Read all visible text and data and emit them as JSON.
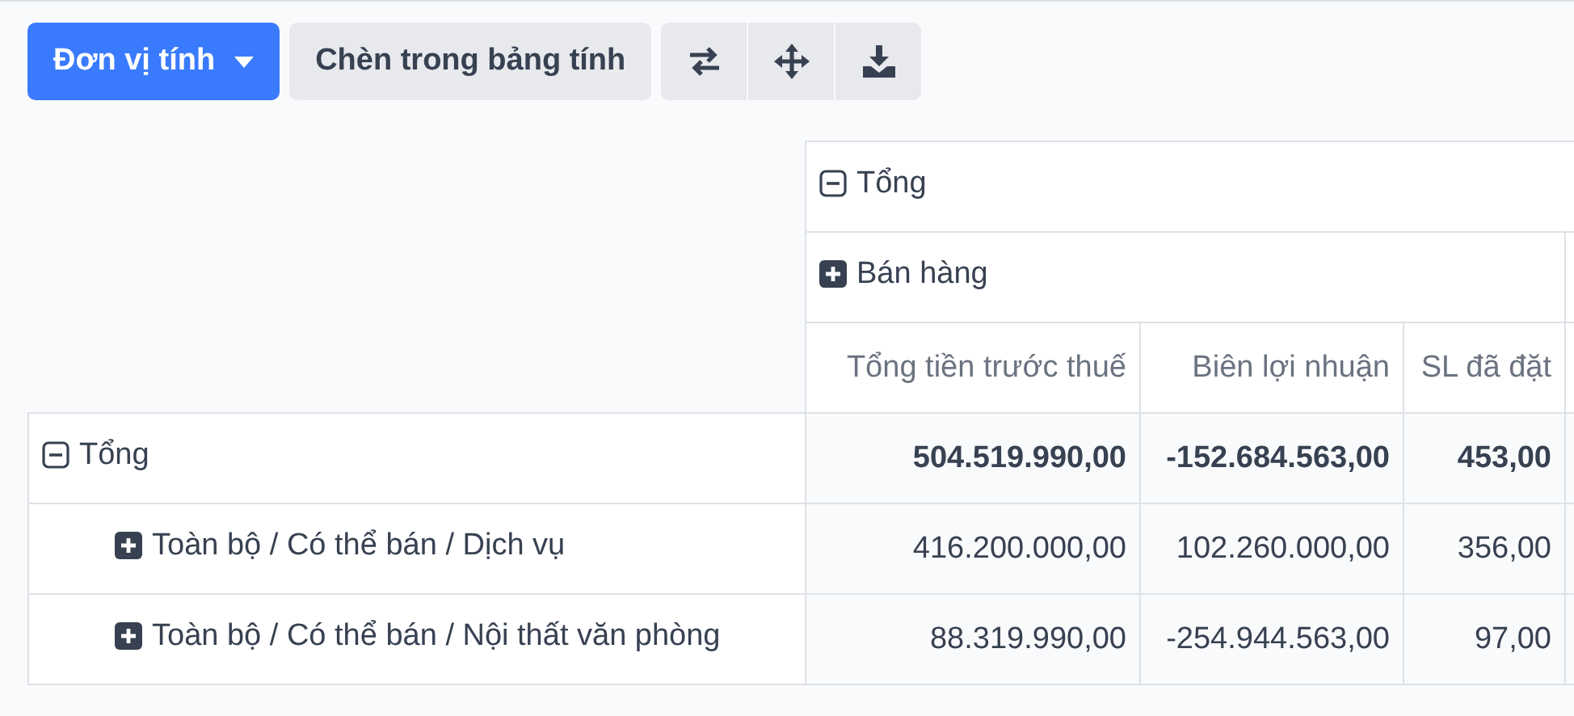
{
  "toolbar": {
    "measure_button": {
      "label": "Đơn vị tính"
    },
    "insert_button": {
      "label": "Chèn trong bảng tính"
    }
  },
  "column_headers": {
    "label": "Tổng",
    "expanded": true,
    "children": [
      {
        "label": "Bán hàng",
        "expanded": false
      }
    ]
  },
  "measures": [
    "Tổng tiền trước thuế",
    "Biên lợi nhuận",
    "SL đã đặt"
  ],
  "rows": [
    {
      "label": "Tổng",
      "expanded": true,
      "values": [
        "504.519.990,00",
        "-152.684.563,00",
        "453,00"
      ],
      "children": [
        {
          "label": "Toàn bộ / Có thể bán / Dịch vụ",
          "expanded": false,
          "values": [
            "416.200.000,00",
            "102.260.000,00",
            "356,00"
          ]
        },
        {
          "label": "Toàn bộ / Có thể bán / Nội thất văn phòng",
          "expanded": false,
          "values": [
            "88.319.990,00",
            "-254.944.563,00",
            "97,00"
          ]
        }
      ]
    }
  ]
}
